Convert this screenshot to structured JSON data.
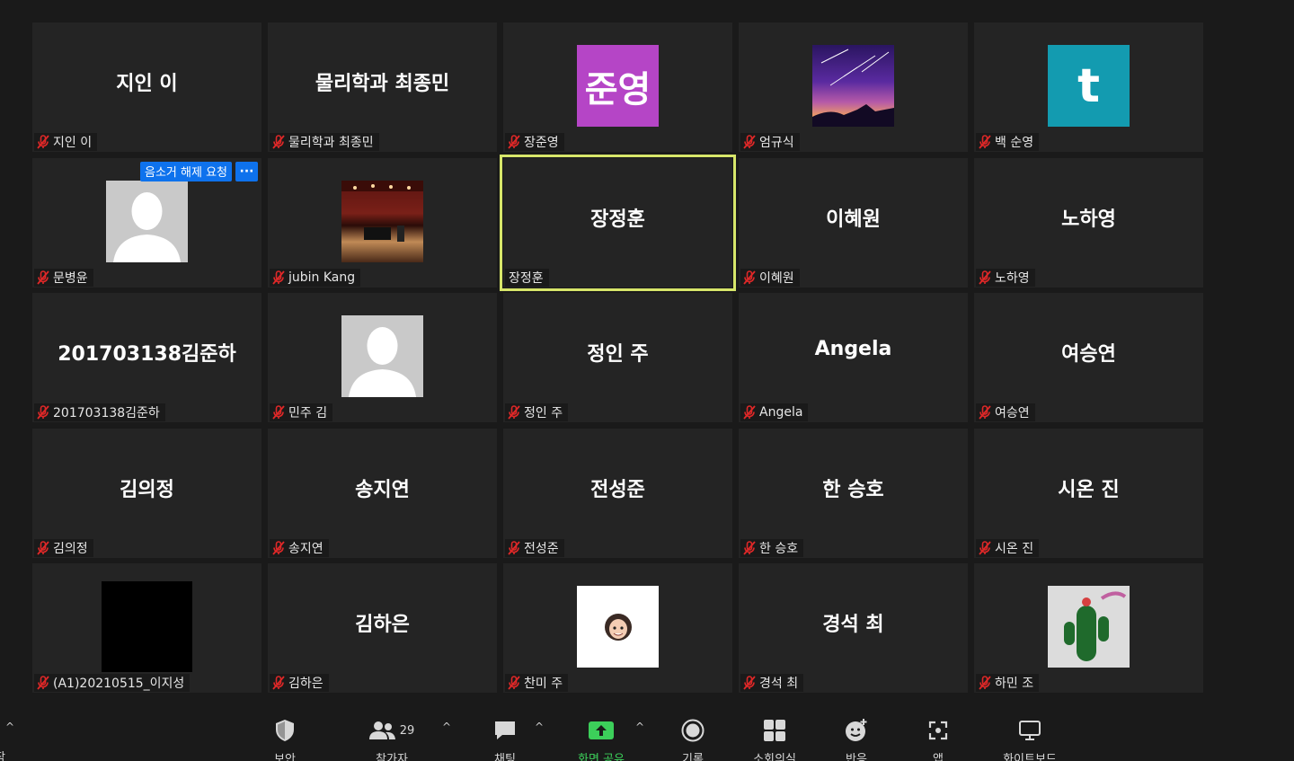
{
  "participants": [
    {
      "display": "지인 이",
      "label": "지인 이"
    },
    {
      "display": "물리학과 최종민",
      "label": "물리학과 최종민"
    },
    {
      "display": "준영",
      "label": "장준영"
    },
    {
      "display": "",
      "label": "엄규식"
    },
    {
      "display": "t",
      "label": "백 순영"
    },
    {
      "display": "",
      "label": "문병윤"
    },
    {
      "display": "",
      "label": "jubin Kang"
    },
    {
      "display": "장정훈",
      "label": "장정훈"
    },
    {
      "display": "이혜원",
      "label": "이혜원"
    },
    {
      "display": "노하영",
      "label": "노하영"
    },
    {
      "display": "201703138김준하",
      "label": "201703138김준하"
    },
    {
      "display": "",
      "label": "민주 김"
    },
    {
      "display": "정인 주",
      "label": "정인 주"
    },
    {
      "display": "Angela",
      "label": "Angela"
    },
    {
      "display": "여승연",
      "label": "여승연"
    },
    {
      "display": "김의정",
      "label": "김의정"
    },
    {
      "display": "송지연",
      "label": "송지연"
    },
    {
      "display": "전성준",
      "label": "전성준"
    },
    {
      "display": "한 승호",
      "label": "한 승호"
    },
    {
      "display": "시온 진",
      "label": "시온 진"
    },
    {
      "display": "",
      "label": "(A1)20210515_이지성"
    },
    {
      "display": "김하은",
      "label": "김하은"
    },
    {
      "display": "",
      "label": "찬미 주"
    },
    {
      "display": "경석 최",
      "label": "경석 최"
    },
    {
      "display": "",
      "label": "하민 조"
    }
  ],
  "overlay": {
    "unmute_request": "음소거 해제 요청",
    "more": "···"
  },
  "toolbar": {
    "security": "보안",
    "participants": "참가자",
    "participant_count": "29",
    "chat": "채팅",
    "share_screen": "화면 공유",
    "record": "기록",
    "breakout": "소회의실",
    "reactions": "반응",
    "apps": "앱",
    "whiteboard": "화이트보드",
    "caret": "^",
    "left_cut_label": "작"
  },
  "colors": {
    "active_speaker": "#d7e66a",
    "accent_blue": "#0e72ed",
    "share_green": "#3ccf5a",
    "muted_red": "#e02828"
  }
}
